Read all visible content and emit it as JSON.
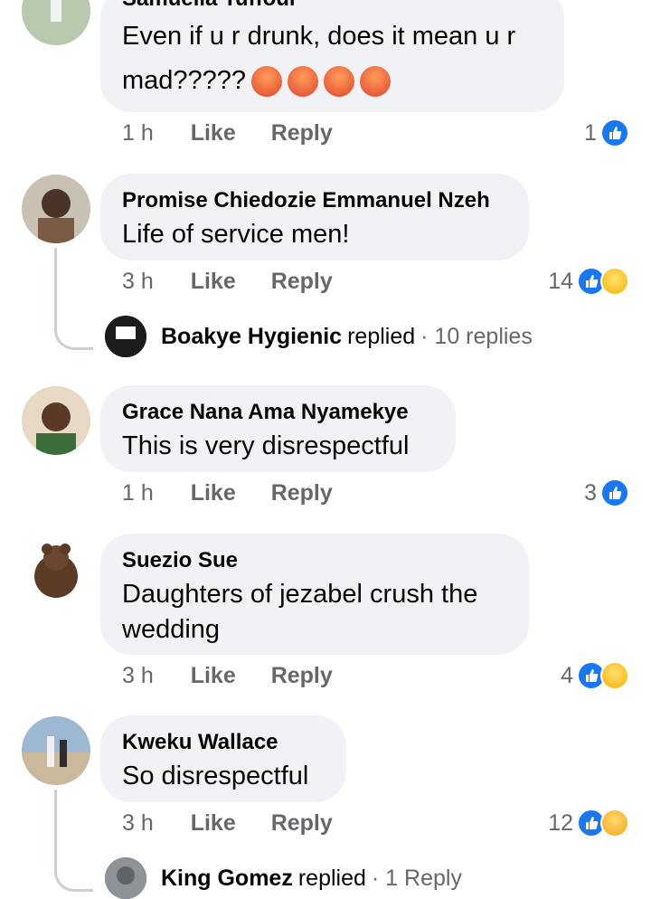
{
  "comments": [
    {
      "author": "Samuella Tuffour",
      "text": "Even if u r drunk, does it mean u r",
      "text2": "mad?????",
      "time": "1 h",
      "like_label": "Like",
      "reply_label": "Reply",
      "reaction_count": "1",
      "reactions": [
        "like-icon"
      ]
    },
    {
      "author": "Promise Chiedozie Emmanuel Nzeh",
      "text": "Life of service men!",
      "time": "3 h",
      "like_label": "Like",
      "reply_label": "Reply",
      "reaction_count": "14",
      "reactions": [
        "like-icon",
        "haha-icon"
      ],
      "reply_thread": {
        "name": "Boakye Hygienic",
        "verb": "replied",
        "count": "· 10 replies"
      }
    },
    {
      "author": "Grace Nana Ama Nyamekye",
      "text": "This is very disrespectful",
      "time": "1 h",
      "like_label": "Like",
      "reply_label": "Reply",
      "reaction_count": "3",
      "reactions": [
        "like-icon"
      ]
    },
    {
      "author": "Suezio Sue",
      "text": "Daughters of jezabel crush the",
      "text2": "wedding",
      "time": "3 h",
      "like_label": "Like",
      "reply_label": "Reply",
      "reaction_count": "4",
      "reactions": [
        "like-icon",
        "haha-icon"
      ]
    },
    {
      "author": "Kweku Wallace",
      "text": "So disrespectful",
      "time": "3 h",
      "like_label": "Like",
      "reply_label": "Reply",
      "reaction_count": "12",
      "reactions": [
        "like-icon",
        "care-icon"
      ],
      "reply_thread": {
        "name": "King Gomez",
        "verb": "replied",
        "count": "· 1 Reply"
      }
    }
  ],
  "colors": {
    "accent": "#1877f2",
    "bubble": "#f0f2f5",
    "meta": "#65676b"
  }
}
